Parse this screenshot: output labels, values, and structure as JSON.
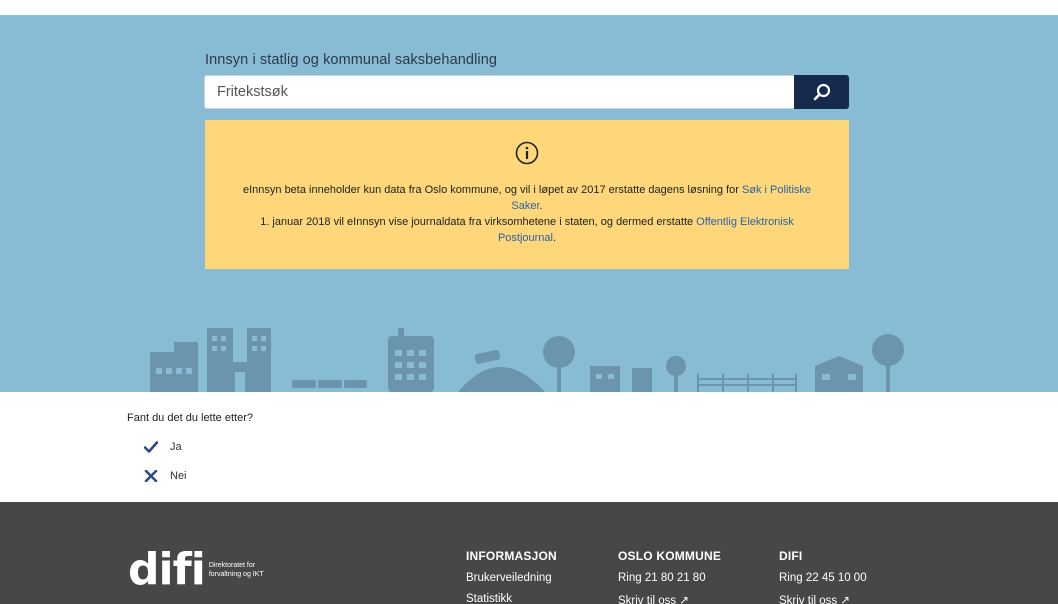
{
  "hero": {
    "title": "Innsyn i statlig og kommunal saksbehandling",
    "search_placeholder": "Fritekstsøk",
    "search_icon": "search-icon",
    "bg_color": "#88bcd5"
  },
  "notice": {
    "icon": "info-circle-icon",
    "line1_text": "eInnsyn beta inneholder kun data fra Oslo kommune, og vil i løpet av 2017 erstatte dagens løsning for ",
    "line1_link": "Søk i Politiske",
    "line2_link": "Saker",
    "line2_tail": ".",
    "line3_text": "1. januar 2018 vil eInnsyn vise journaldata fra virksomhetene i staten, og dermed erstatte ",
    "line3_link": "Offentlig Elektronisk",
    "line4_link": "Postjournal",
    "line4_tail": ".",
    "bg_color": "#fdd77a",
    "link_color": "#2b63a6"
  },
  "feedback": {
    "question": "Fant du det du lette etter?",
    "yes_label": "Ja",
    "no_label": "Nei"
  },
  "footer": {
    "logo_word": "difi",
    "logo_sub_line1": "Direktoratet for",
    "logo_sub_line2": "forvaltning og IKT",
    "columns": [
      {
        "heading": "INFORMASJON",
        "items": [
          "Brukerveiledning",
          "Statistikk"
        ]
      },
      {
        "heading": "OSLO KOMMUNE",
        "items": [
          "Ring 21 80 21 80",
          "Skriv til oss ↗"
        ]
      },
      {
        "heading": "DIFI",
        "items": [
          "Ring 22 45 10 00",
          "Skriv til oss ↗"
        ]
      }
    ],
    "bg_color": "#474747"
  }
}
